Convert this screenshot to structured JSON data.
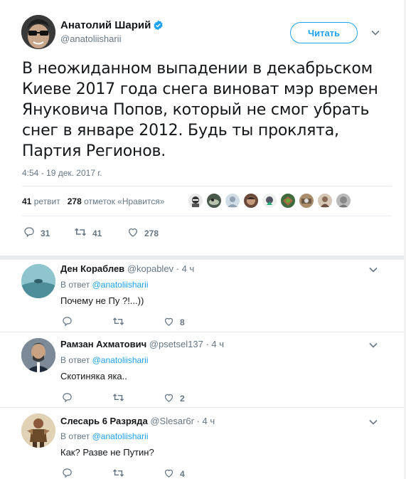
{
  "main_tweet": {
    "author_name": "Анатолий Шарий",
    "handle": "@anatoliisharii",
    "follow_label": "Читать",
    "text": "В неожиданном выпадении в декабрьском Киеве 2017 года снега виноват мэр времен Януковича Попов, который не смог убрать снег в январе 2012. Будь ты проклята, Партия Регионов.",
    "timestamp": "4:54 - 19 дек. 2017 г.",
    "retweets_count": "41",
    "retweets_label": "ретвит",
    "likes_count": "278",
    "likes_label": "отметок «Нравится»",
    "action_reply_count": "31",
    "action_retweet_count": "41",
    "action_like_count": "278",
    "colors": {
      "accent": "#1da1f2",
      "muted": "#657786",
      "text": "#14171a",
      "divider": "#e6ecf0"
    }
  },
  "replies": [
    {
      "name": "Ден Кораблев",
      "handle": "@kopablev",
      "time": "· 4 ч",
      "in_reply_prefix": "В ответ",
      "in_reply_to": "@anatoliisharii",
      "text": "Почему не Пу ?!...))",
      "like_count": "8"
    },
    {
      "name": "Рамзан Ахматович",
      "handle": "@psetsel137",
      "time": "· 4 ч",
      "in_reply_prefix": "В ответ",
      "in_reply_to": "@anatoliisharii",
      "text": "Скотиняка яка..",
      "like_count": "2"
    },
    {
      "name": "Слесарь 6 Разряда",
      "handle": "@Slesar6r",
      "time": "· 4 ч",
      "in_reply_prefix": "В ответ",
      "in_reply_to": "@anatoliisharii",
      "text": "Как? Разве не Путин?",
      "like_count": "4"
    }
  ]
}
